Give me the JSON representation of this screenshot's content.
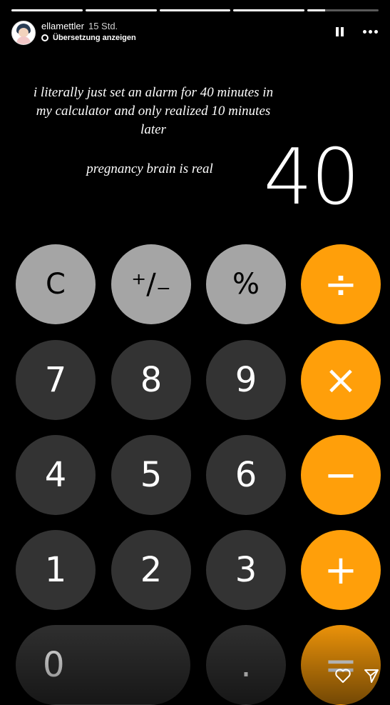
{
  "story": {
    "username": "ellamettler",
    "time": "15 Std.",
    "translate_label": "Übersetzung anzeigen",
    "progress": [
      1,
      1,
      1,
      1,
      0.25
    ]
  },
  "caption": {
    "line1": "i literally just set an alarm for 40 minutes in my calculator and only realized 10 minutes later",
    "line2": "pregnancy brain is real"
  },
  "calculator": {
    "display": "40",
    "keys": {
      "clear": "C",
      "sign": "⁺∕₋",
      "percent": "%",
      "divide": "÷",
      "seven": "7",
      "eight": "8",
      "nine": "9",
      "multiply": "×",
      "four": "4",
      "five": "5",
      "six": "6",
      "minus": "−",
      "one": "1",
      "two": "2",
      "three": "3",
      "plus": "+",
      "zero": "0",
      "decimal": ".",
      "equals": "="
    }
  },
  "colors": {
    "function_key": "#a5a5a5",
    "digit_key": "#333333",
    "operator_key": "#ff9f0a"
  },
  "icons": [
    "pause-icon",
    "more-options-icon",
    "translate-icon",
    "heart-icon",
    "send-icon"
  ]
}
